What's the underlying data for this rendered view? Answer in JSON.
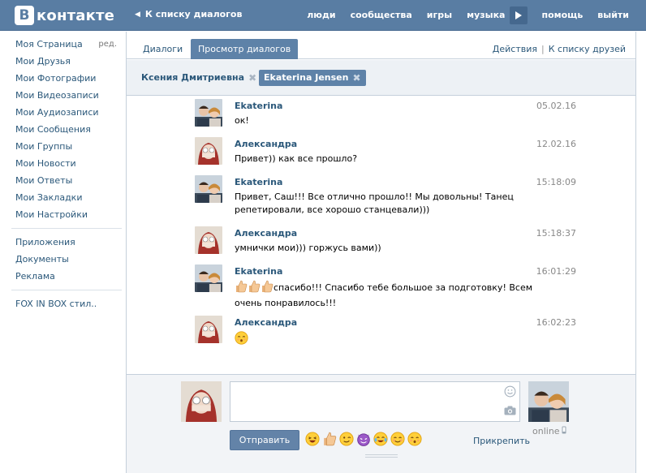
{
  "header": {
    "logo_letter": "В",
    "logo_text": "контакте",
    "back_label": "К списку диалогов",
    "nav": [
      "люди",
      "сообщества",
      "игры",
      "музыка",
      "помощь",
      "выйти"
    ]
  },
  "leftmenu": {
    "edit_label": "ред.",
    "group1": [
      "Моя Страница",
      "Мои Друзья",
      "Мои Фотографии",
      "Мои Видеозаписи",
      "Мои Аудиозаписи",
      "Мои Сообщения",
      "Мои Группы",
      "Мои Новости",
      "Мои Ответы",
      "Мои Закладки",
      "Мои Настройки"
    ],
    "group2": [
      "Приложения",
      "Документы",
      "Реклама"
    ],
    "group3": [
      "FOX IN BOX стил.."
    ]
  },
  "tabs": {
    "dialogs": "Диалоги",
    "view_dialogs": "Просмотр диалогов",
    "actions": "Действия",
    "to_friends": "К списку друзей"
  },
  "peers": [
    "Ксения Дмитриевна",
    "Ekaterina Jensen"
  ],
  "messages": [
    {
      "author": "Ekaterina",
      "time": "05.02.16",
      "text": "ок!",
      "who": "e"
    },
    {
      "author": "Александра",
      "time": "12.02.16",
      "text": "Привет)) как все прошло?",
      "who": "a"
    },
    {
      "author": "Ekaterina",
      "time": "15:18:09",
      "text": "Привет, Саш!!! Все отлично прошло!! Мы довольны! Танец репетировали, все хорошо станцевали)))",
      "who": "e"
    },
    {
      "author": "Александра",
      "time": "15:18:37",
      "text": "умнички мои))) горжусь вами))",
      "who": "a"
    },
    {
      "author": "Ekaterina",
      "time": "16:01:29",
      "text": "спасибо!!! Спасибо тебе большое за подготовку! Всем очень понравилось!!!",
      "who": "e"
    },
    {
      "author": "Александра",
      "time": "16:02:23",
      "text": "",
      "who": "a"
    }
  ],
  "composer": {
    "send_label": "Отправить",
    "attach_label": "Прикрепить",
    "online_label": "online"
  },
  "colors": {
    "header_bg": "#597da3",
    "link": "#2b587a",
    "active_tab": "#5e82a8",
    "peer_bar": "#edf1f5"
  }
}
